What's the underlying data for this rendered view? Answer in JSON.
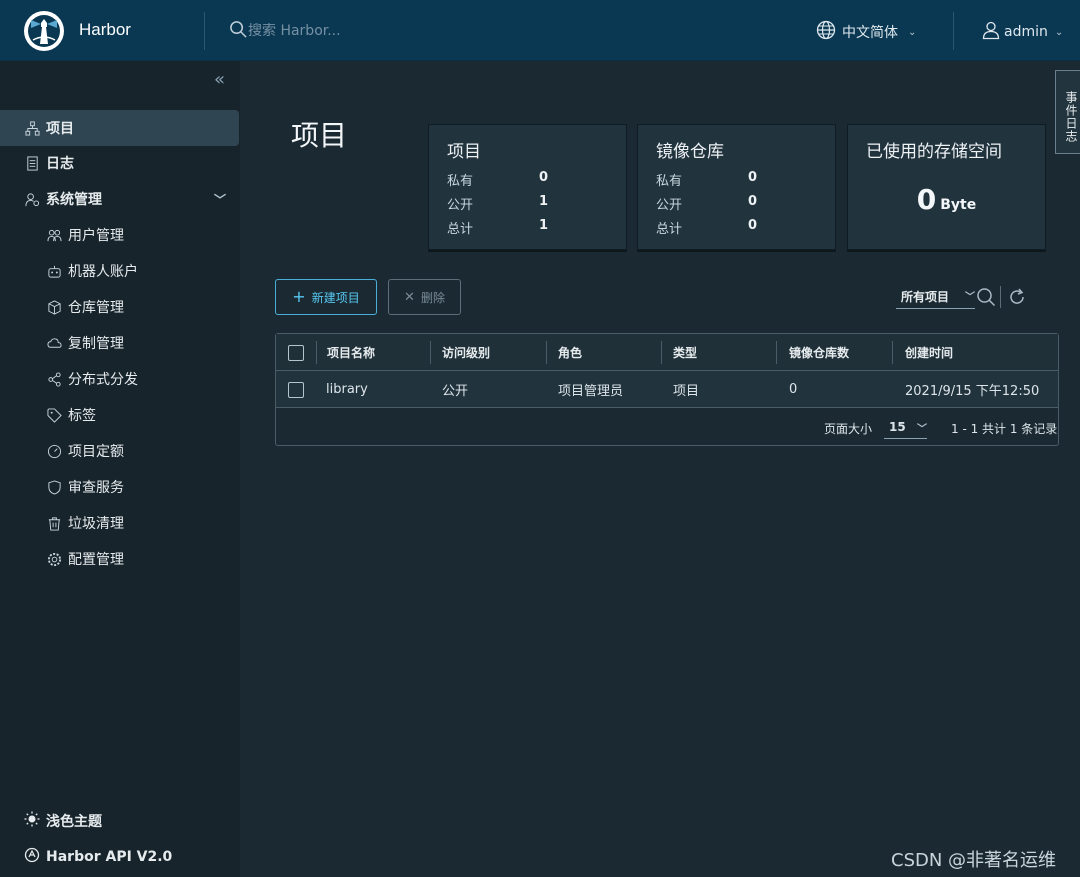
{
  "header": {
    "brand": "Harbor",
    "search_placeholder": "搜索 Harbor...",
    "language": "中文简体",
    "user": "admin"
  },
  "sidebar": {
    "collapse_glyph": "«",
    "items": [
      {
        "label": "项目",
        "icon": "project-icon",
        "active": true
      },
      {
        "label": "日志",
        "icon": "log-icon"
      },
      {
        "label": "系统管理",
        "icon": "admin-icon",
        "expanded": true
      },
      {
        "label": "用户管理",
        "icon": "users-icon"
      },
      {
        "label": "机器人账户",
        "icon": "robot-icon"
      },
      {
        "label": "仓库管理",
        "icon": "cube-icon"
      },
      {
        "label": "复制管理",
        "icon": "cloud-sync-icon"
      },
      {
        "label": "分布式分发",
        "icon": "share-icon"
      },
      {
        "label": "标签",
        "icon": "tag-icon"
      },
      {
        "label": "项目定额",
        "icon": "gauge-icon"
      },
      {
        "label": "审查服务",
        "icon": "shield-icon"
      },
      {
        "label": "垃圾清理",
        "icon": "trash-icon"
      },
      {
        "label": "配置管理",
        "icon": "gear-icon"
      }
    ],
    "theme_label": "浅色主题",
    "api_label": "Harbor API V2.0"
  },
  "event_tab": "事件日志",
  "page_title": "项目",
  "cards": {
    "projects": {
      "title": "项目",
      "rows": [
        {
          "label": "私有",
          "value": "0"
        },
        {
          "label": "公开",
          "value": "1"
        },
        {
          "label": "总计",
          "value": "1"
        }
      ]
    },
    "repos": {
      "title": "镜像仓库",
      "rows": [
        {
          "label": "私有",
          "value": "0"
        },
        {
          "label": "公开",
          "value": "0"
        },
        {
          "label": "总计",
          "value": "0"
        }
      ]
    },
    "storage": {
      "title": "已使用的存储空间",
      "value": "0",
      "unit": "Byte"
    }
  },
  "toolbar": {
    "new_label": "新建项目",
    "delete_label": "删除",
    "filter_label": "所有项目"
  },
  "table": {
    "columns": [
      "项目名称",
      "访问级别",
      "角色",
      "类型",
      "镜像仓库数",
      "创建时间"
    ],
    "rows": [
      {
        "name": "library",
        "access": "公开",
        "role": "项目管理员",
        "type": "项目",
        "repo_count": "0",
        "created": "2021/9/15 下午12:50"
      }
    ],
    "footer": {
      "page_size_label": "页面大小",
      "page_size": "15",
      "info": "1 - 1 共计 1 条记录"
    }
  },
  "watermark": "CSDN @非著名运维",
  "colors": {
    "header_bg": "#0a3852",
    "sidebar_bg": "#17242b",
    "content_bg": "#1b2a32",
    "accent": "#49afd9",
    "link": "#4aaed9"
  }
}
